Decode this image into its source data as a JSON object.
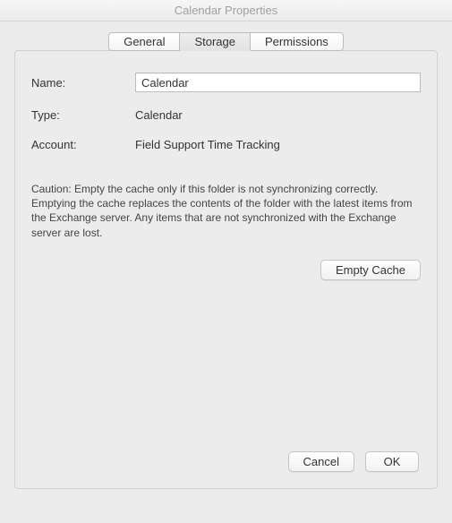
{
  "window": {
    "title": "Calendar Properties"
  },
  "tabs": {
    "general": "General",
    "storage": "Storage",
    "permissions": "Permissions"
  },
  "form": {
    "name_label": "Name:",
    "name_value": "Calendar",
    "type_label": "Type:",
    "type_value": "Calendar",
    "account_label": "Account:",
    "account_value": "Field Support Time Tracking"
  },
  "caution_text": "Caution: Empty the cache only if this folder is not synchronizing correctly. Emptying the cache replaces the contents of the folder with the latest items from the Exchange server. Any items that are not synchronized with the Exchange server are lost.",
  "buttons": {
    "empty_cache": "Empty Cache",
    "cancel": "Cancel",
    "ok": "OK"
  }
}
